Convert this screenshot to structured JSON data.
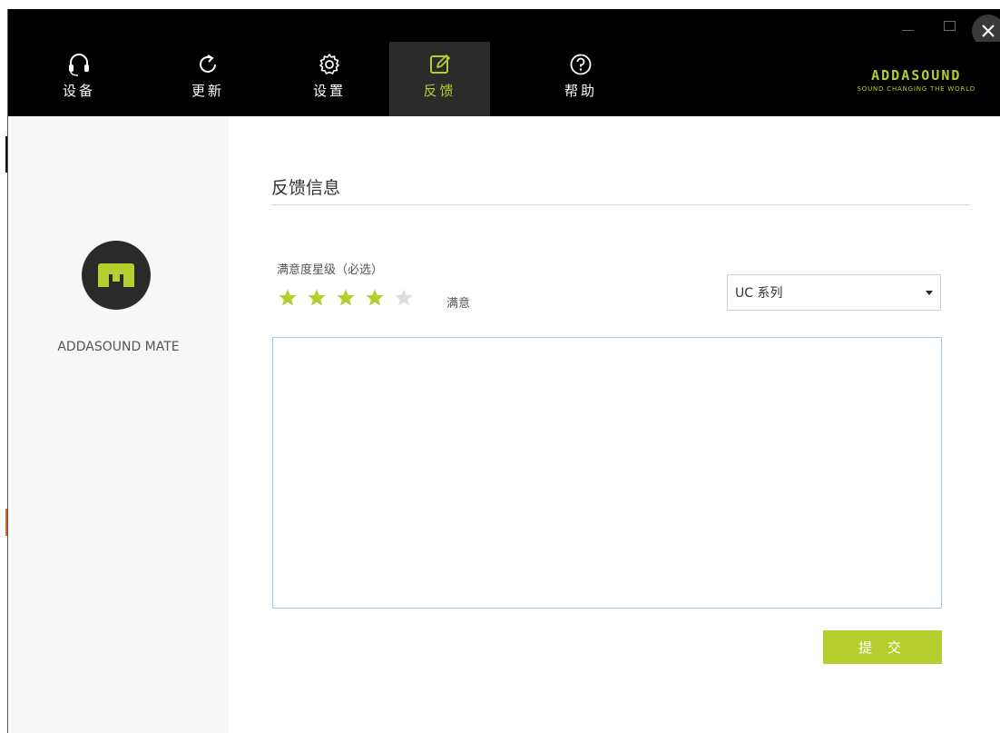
{
  "window": {
    "minimize_icon": "minimize-icon",
    "maximize_icon": "maximize-icon",
    "close_icon": "close-icon"
  },
  "nav": {
    "items": [
      {
        "label": "设备",
        "icon": "headset-icon"
      },
      {
        "label": "更新",
        "icon": "refresh-icon"
      },
      {
        "label": "设置",
        "icon": "gear-icon"
      },
      {
        "label": "反馈",
        "icon": "edit-icon",
        "active": true
      },
      {
        "label": "帮助",
        "icon": "help-icon"
      }
    ],
    "brand": {
      "name": "ADDASOUND",
      "slogan": "SOUND CHANGING THE WORLD"
    }
  },
  "sidebar": {
    "device_name": "ADDASOUND MATE",
    "avatar_icon": "m-logo-icon"
  },
  "feedback": {
    "title": "反馈信息",
    "rating_label": "满意度星级（必选）",
    "rating": 4,
    "rating_max": 5,
    "rating_text": "满意",
    "series_select": {
      "value": "UC 系列"
    },
    "textarea": {
      "value": ""
    },
    "submit_label": "提 交"
  },
  "colors": {
    "accent": "#b6cd2e",
    "nav_bg": "#000000",
    "active_tab_bg": "#2b2b2b",
    "star_empty": "#dddddd"
  }
}
